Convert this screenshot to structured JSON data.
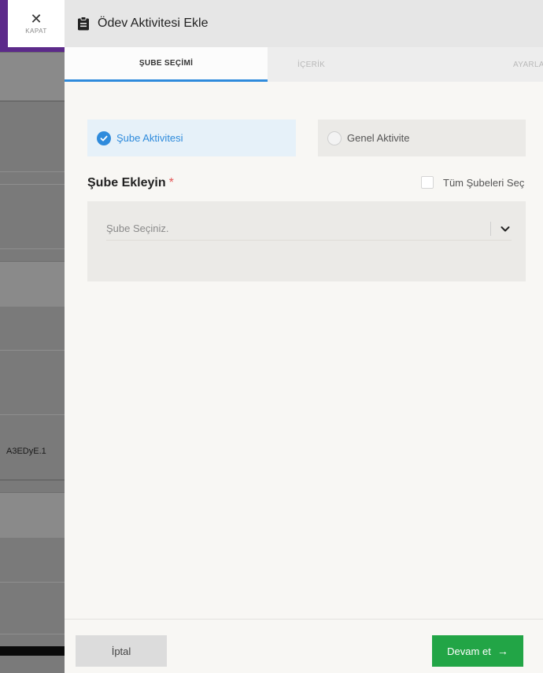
{
  "background": {
    "partial_text": "A3EDyE.1"
  },
  "close": {
    "label": "KAPAT",
    "icon": "close-icon"
  },
  "header": {
    "title": "Ödev Aktivitesi Ekle",
    "icon": "clipboard-icon"
  },
  "tabs": [
    {
      "label": "ŞUBE SEÇİMİ",
      "active": true
    },
    {
      "label": "İÇERİK",
      "active": false
    },
    {
      "label": "AYARLAR",
      "active": false
    }
  ],
  "activity_type": {
    "options": [
      {
        "label": "Şube Aktivitesi",
        "selected": true
      },
      {
        "label": "Genel Aktivite",
        "selected": false
      }
    ]
  },
  "branch": {
    "title": "Şube Ekleyin",
    "required_mark": "*",
    "select_all_label": "Tüm Şubeleri Seç",
    "placeholder": "Şube Seçiniz."
  },
  "footer": {
    "cancel_label": "İptal",
    "next_label": "Devam et",
    "next_icon": "arrow-right-icon"
  },
  "colors": {
    "accent": "#2f8bdc",
    "success": "#22a546",
    "required": "#e35656",
    "brand_purple": "#5c2a8a"
  }
}
